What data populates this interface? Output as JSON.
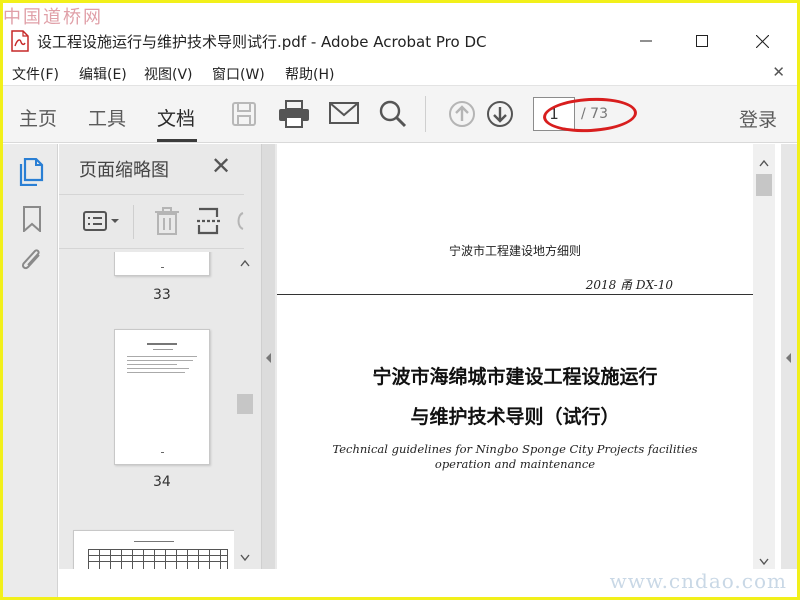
{
  "watermark": {
    "top": "中国道桥网",
    "bottom": "www.cndao.com"
  },
  "window": {
    "title": "设工程设施运行与维护技术导则试行.pdf - Adobe Acrobat Pro DC"
  },
  "menu": [
    "文件(F)",
    "编辑(E)",
    "视图(V)",
    "窗口(W)",
    "帮助(H)"
  ],
  "toolbar": {
    "tabs": [
      "主页",
      "工具",
      "文档"
    ],
    "active_tab": "文档",
    "current_page": "1",
    "total_pages": "/ 73",
    "login": "登录"
  },
  "thumbnails": {
    "title": "页面缩略图",
    "pages": [
      "33",
      "34"
    ]
  },
  "document": {
    "header": "宁波市工程建设地方细则",
    "code": "2018 甬  DX-10",
    "title_line1": "宁波市海绵城市建设工程设施运行",
    "title_line2": "与维护技术导则（试行）",
    "english_line1": "Technical guidelines for Ningbo Sponge City Projects facilities",
    "english_line2": "operation and maintenance"
  },
  "colors": {
    "accent": "#2a7fd4",
    "annotation": "#d81e1e",
    "frame": "#f2f01a"
  }
}
